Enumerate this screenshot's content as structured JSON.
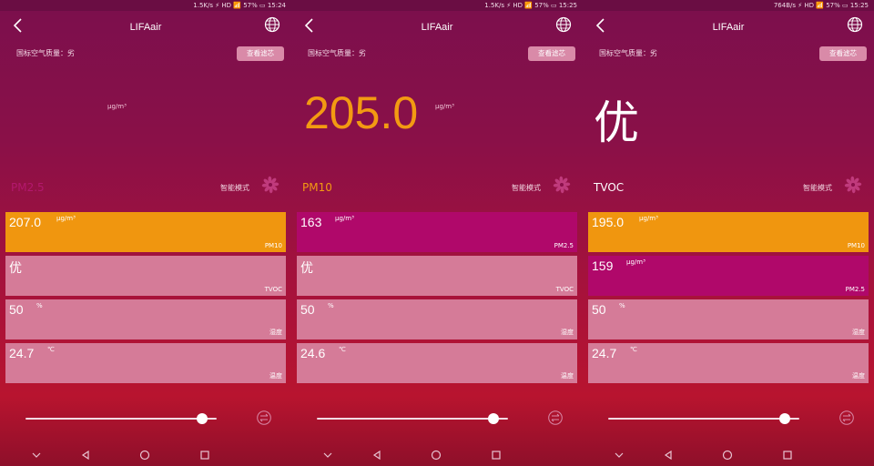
{
  "screens": [
    {
      "status": "1.5K/s ⚡ HD 📶 57% ▭ 15:24",
      "title": "LIFAair",
      "quality_label": "国标空气质量：劣",
      "filter_button": "查看滤芯",
      "big_value": "",
      "big_unit": "μg/m³",
      "metric_name": "PM2.5",
      "mode_label": "智能模式",
      "cards": [
        {
          "value": "207.0",
          "unit": "μg/m³",
          "name": "PM10"
        },
        {
          "value": "优",
          "unit": "",
          "name": "TVOC"
        },
        {
          "value": "50",
          "unit": "%",
          "name": "湿度"
        },
        {
          "value": "24.7",
          "unit": "℃",
          "name": "温度"
        }
      ]
    },
    {
      "status": "1.5K/s ⚡ HD 📶 57% ▭ 15:25",
      "title": "LIFAair",
      "quality_label": "国标空气质量：劣",
      "filter_button": "查看滤芯",
      "big_value": "205.0",
      "big_unit": "μg/m³",
      "metric_name": "PM10",
      "mode_label": "智能模式",
      "cards": [
        {
          "value": "163",
          "unit": "μg/m³",
          "name": "PM2.5"
        },
        {
          "value": "优",
          "unit": "",
          "name": "TVOC"
        },
        {
          "value": "50",
          "unit": "%",
          "name": "湿度"
        },
        {
          "value": "24.6",
          "unit": "℃",
          "name": "温度"
        }
      ]
    },
    {
      "status": "764B/s ⚡ HD 📶 57% ▭ 15:25",
      "title": "LIFAair",
      "quality_label": "国标空气质量：劣",
      "filter_button": "查看滤芯",
      "big_value": "优",
      "big_unit": "",
      "metric_name": "TVOC",
      "mode_label": "智能模式",
      "cards": [
        {
          "value": "195.0",
          "unit": "μg/m³",
          "name": "PM10"
        },
        {
          "value": "159",
          "unit": "μg/m³",
          "name": "PM2.5"
        },
        {
          "value": "50",
          "unit": "%",
          "name": "湿度"
        },
        {
          "value": "24.7",
          "unit": "℃",
          "name": "温度"
        }
      ]
    }
  ],
  "colors": {
    "orange": "#f0960f",
    "magenta": "#b0086a",
    "pink": "#d57b98"
  }
}
